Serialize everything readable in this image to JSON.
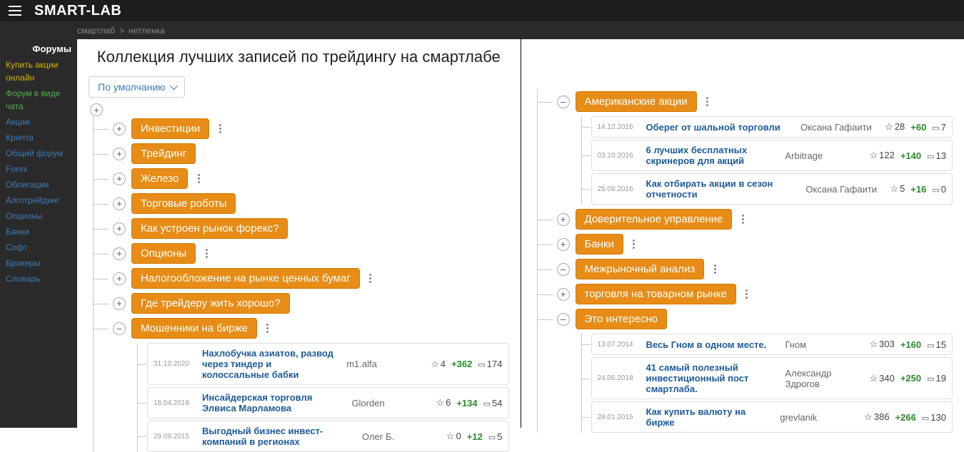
{
  "header": {
    "logo": "SMART-LAB"
  },
  "breadcrumb": {
    "a": "смартлаб",
    "sep": ">",
    "b": "нетленка"
  },
  "sidebar": {
    "head": "Форумы",
    "items": [
      {
        "label": "Купить акции онлайн",
        "cls": "hl1"
      },
      {
        "label": "Форум в виде чата",
        "cls": "hl2"
      },
      {
        "label": "Акции",
        "cls": ""
      },
      {
        "label": "Крипта",
        "cls": ""
      },
      {
        "label": "Общий форум",
        "cls": ""
      },
      {
        "label": "Forex",
        "cls": ""
      },
      {
        "label": "Облигации",
        "cls": ""
      },
      {
        "label": "Алготрейдинг",
        "cls": ""
      },
      {
        "label": "Опционы",
        "cls": ""
      },
      {
        "label": "Банки",
        "cls": ""
      },
      {
        "label": "Софт",
        "cls": ""
      },
      {
        "label": "Брокеры",
        "cls": ""
      },
      {
        "label": "Словарь",
        "cls": ""
      }
    ]
  },
  "page_title": "Коллекция лучших записей по трейдингу на смартлабе",
  "sort_label": "По умолчанию",
  "left": {
    "cats": [
      {
        "toggle": "+",
        "label": "Инвестиции",
        "more": true
      },
      {
        "toggle": "+",
        "label": "Трейдинг",
        "more": false
      },
      {
        "toggle": "+",
        "label": "Железо",
        "more": true
      },
      {
        "toggle": "+",
        "label": "Торговые роботы",
        "more": false
      },
      {
        "toggle": "+",
        "label": "Как устроен рынок форекс?",
        "more": false
      },
      {
        "toggle": "+",
        "label": "Опционы",
        "more": true
      },
      {
        "toggle": "+",
        "label": "Налогообложение на рынке ценных бумаг",
        "more": true
      },
      {
        "toggle": "+",
        "label": "Где трейдеру жить хорошо?",
        "more": false
      }
    ],
    "open_cat": {
      "toggle": "–",
      "label": "Мошенники на бирже",
      "more": true
    },
    "posts": [
      {
        "date": "31.10.2020",
        "title": "Нахлобучка азиатов, развод через тиндер и колоссальные бабки",
        "author": "m1.alfa",
        "stars": "4",
        "votes": "+362",
        "comments": "174"
      },
      {
        "date": "18.04.2018",
        "title": "Инсайдерская торговля Элвиса Марламова",
        "author": "Glorden",
        "stars": "6",
        "votes": "+134",
        "comments": "54"
      },
      {
        "date": "29.09.2015",
        "title": "Выгодный бизнес инвест-компаний в регионах",
        "author": "Олег Б.",
        "stars": "0",
        "votes": "+12",
        "comments": "5"
      }
    ]
  },
  "right": {
    "group1": {
      "toggle": "–",
      "label": "Американские акции",
      "more": true
    },
    "group1_posts": [
      {
        "date": "14.12.2016",
        "title": "Оберег от шальной торговли",
        "author": "Оксана Гафаити",
        "stars": "28",
        "votes": "+60",
        "comments": "7"
      },
      {
        "date": "03.10.2016",
        "title": "6 лучших бесплатных скринеров для акций",
        "author": "Arbitrage",
        "stars": "122",
        "votes": "+140",
        "comments": "13"
      },
      {
        "date": "25.08.2016",
        "title": "Как отбирать акции в сезон отчетности",
        "author": "Оксана Гафаити",
        "stars": "5",
        "votes": "+16",
        "comments": "0"
      }
    ],
    "cats": [
      {
        "toggle": "+",
        "label": "Доверительное управление",
        "more": true
      },
      {
        "toggle": "+",
        "label": "Банки",
        "more": true
      },
      {
        "toggle": "–",
        "label": "Межрыночный анализ",
        "more": true
      },
      {
        "toggle": "+",
        "label": "торговля на товарном рынке",
        "more": true
      }
    ],
    "group2": {
      "toggle": "–",
      "label": "Это интересно",
      "more": false
    },
    "group2_posts": [
      {
        "date": "13.07.2014",
        "title": "Весь Гном в одном месте.",
        "author": "Гном",
        "stars": "303",
        "votes": "+160",
        "comments": "15"
      },
      {
        "date": "24.06.2018",
        "title": "41 самый полезный инвестиционный пост смартлаба.",
        "author": "Александр Здрогов",
        "stars": "340",
        "votes": "+250",
        "comments": "19"
      },
      {
        "date": "28.01.2015",
        "title": "Как купить валюту на бирже",
        "author": "grevlanik",
        "stars": "386",
        "votes": "+266",
        "comments": "130"
      }
    ]
  }
}
